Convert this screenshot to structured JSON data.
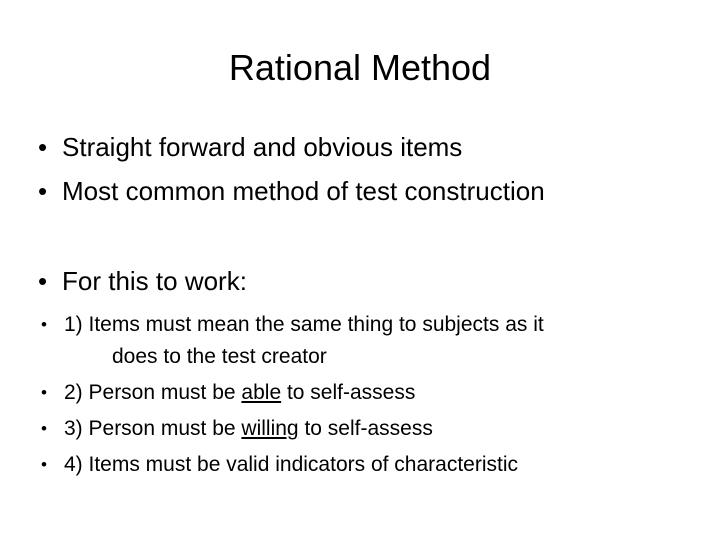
{
  "slide": {
    "title": "Rational Method",
    "background_color": "#ffffff",
    "text_color": "#000000",
    "bullet_glyph": "•",
    "main_points": [
      {
        "text": "Straight forward and obvious items"
      },
      {
        "text": "Most common method of test construction"
      }
    ],
    "condition_heading": "For this to work:",
    "conditions": [
      {
        "line1": "1) Items must mean the same thing to subjects as it",
        "line2": "does to the test creator"
      },
      {
        "prefix": "2) Person must be ",
        "emphasis": "able",
        "suffix": " to self-assess"
      },
      {
        "prefix": "3) Person must be ",
        "emphasis": "willing",
        "suffix": " to self-assess"
      },
      {
        "text": "4) Items must be valid indicators of characteristic"
      }
    ]
  }
}
